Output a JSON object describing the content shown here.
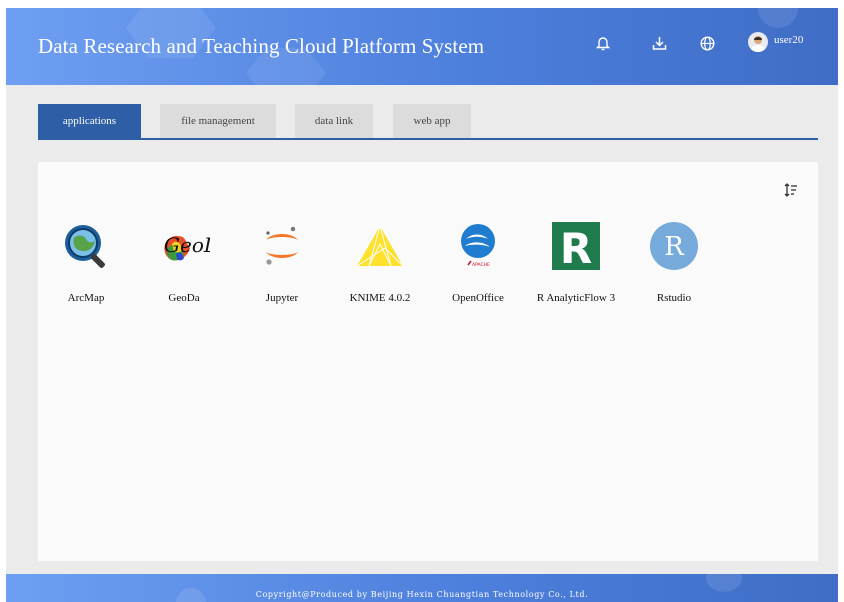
{
  "header": {
    "title": "Data Research and Teaching Cloud Platform System",
    "username": "user20",
    "icons": [
      "bell-icon",
      "download-icon",
      "globe-icon",
      "avatar"
    ]
  },
  "tabs": [
    {
      "label": "applications",
      "active": true
    },
    {
      "label": "file management",
      "active": false
    },
    {
      "label": "data link",
      "active": false
    },
    {
      "label": "web app",
      "active": false
    }
  ],
  "panel": {
    "sort_icon": "sort-icon",
    "apps": [
      {
        "label": "ArcMap",
        "icon": "arcmap-icon"
      },
      {
        "label": "GeoDa",
        "icon": "geoda-icon"
      },
      {
        "label": "Jupyter",
        "icon": "jupyter-icon"
      },
      {
        "label": "KNIME 4.0.2",
        "icon": "knime-icon"
      },
      {
        "label": "OpenOffice",
        "icon": "openoffice-icon"
      },
      {
        "label": "R AnalyticFlow 3",
        "icon": "r-analyticflow-icon"
      },
      {
        "label": "Rstudio",
        "icon": "rstudio-icon"
      }
    ]
  },
  "footer": {
    "copyright": "Copyright@Produced by Beijing Hexin Chuangtian Technology Co., Ltd."
  },
  "colors": {
    "header_start": "#6f9ff2",
    "header_end": "#3f6dc6",
    "tab_active": "#2e5ea6",
    "tab_inactive": "#dcdcdc",
    "page_bg": "#ebebeb",
    "panel_bg": "#fafafa"
  }
}
